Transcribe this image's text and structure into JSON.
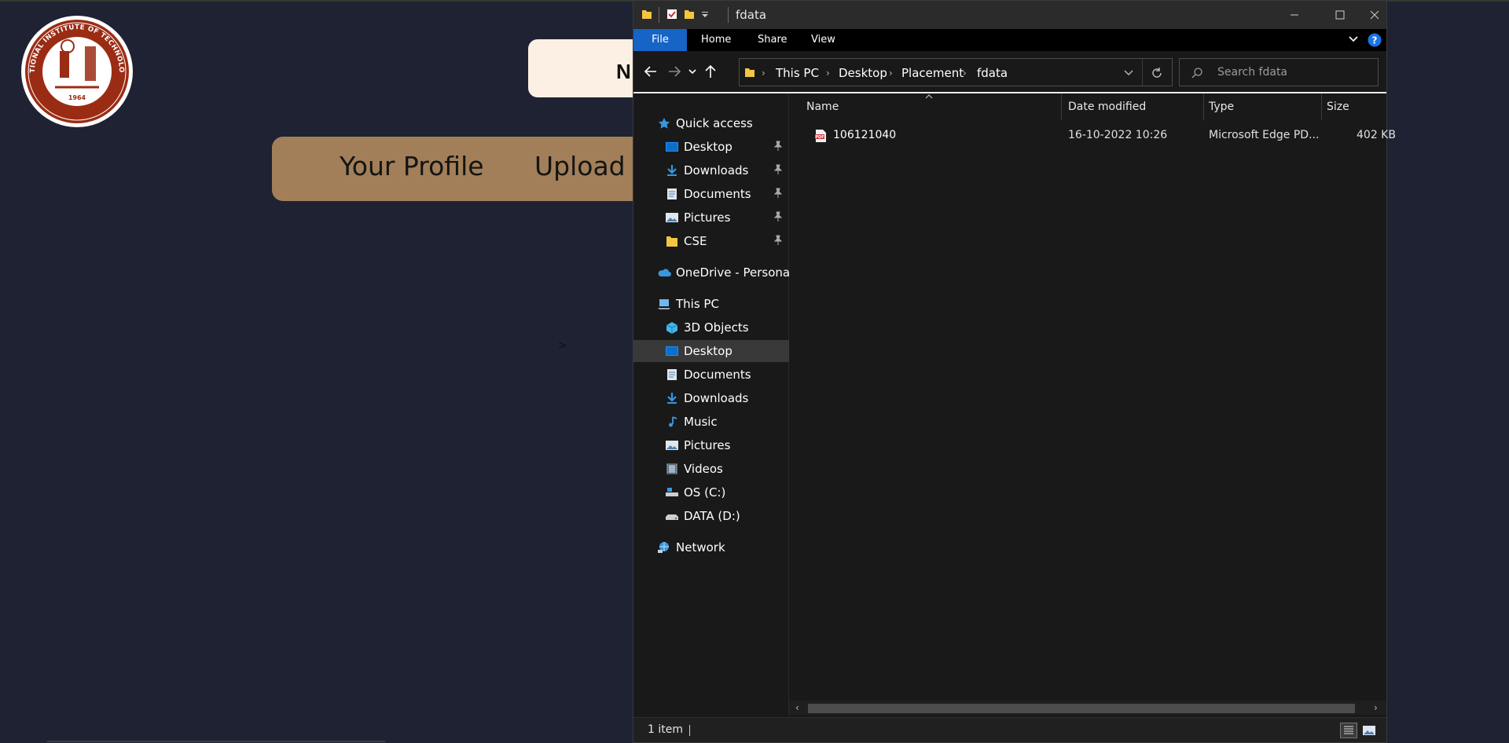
{
  "webpage": {
    "logo_text_top": "NATIONAL INSTITUTE OF TECHNOLOGY",
    "logo_text_bottom": "TIRUCHIRAPPALLI",
    "logo_year": "1964",
    "banner_text": "N",
    "nav": [
      "Your Profile",
      "Upload I"
    ],
    "caret": ">"
  },
  "explorer": {
    "title": "fdata",
    "ribbon_tabs": [
      "File",
      "Home",
      "Share",
      "View"
    ],
    "breadcrumb": [
      "This PC",
      "Desktop",
      "Placement",
      "fdata"
    ],
    "search_placeholder": "Search fdata",
    "quick_access": {
      "label": "Quick access",
      "items": [
        "Desktop",
        "Downloads",
        "Documents",
        "Pictures",
        "CSE"
      ]
    },
    "onedrive": "OneDrive - Personal",
    "this_pc": {
      "label": "This PC",
      "items": [
        "3D Objects",
        "Desktop",
        "Documents",
        "Downloads",
        "Music",
        "Pictures",
        "Videos",
        "OS (C:)",
        "DATA (D:)"
      ]
    },
    "network": "Network",
    "columns": [
      "Name",
      "Date modified",
      "Type",
      "Size"
    ],
    "files": [
      {
        "name": "106121040",
        "date": "16-10-2022 10:26",
        "type": "Microsoft Edge PD...",
        "size": "402 KB",
        "icon": "pdf-file-icon"
      }
    ],
    "status": "1 item",
    "colors": {
      "accent": "#1664c6",
      "selection": "#393939",
      "background": "#191919"
    }
  }
}
